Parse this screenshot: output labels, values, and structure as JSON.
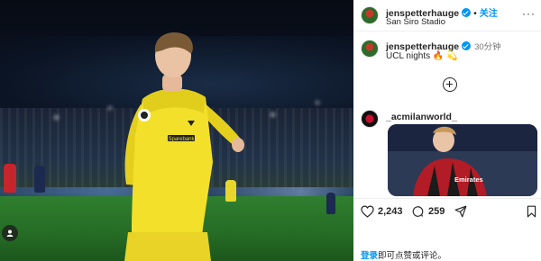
{
  "post": {
    "photo_alt": "",
    "author": {
      "username": "jenspetterhauge",
      "follow_label": "关注",
      "separator": "•",
      "location": "San Siro Stadio"
    },
    "caption": {
      "username": "jenspetterhauge",
      "time_ago": "30分钟",
      "text": "UCL nights 🔥 💫"
    },
    "comment": {
      "username": "_acmilanworld_",
      "embed_image_text": "Emirates"
    },
    "actions": {
      "likes": "2,243",
      "comments": "259"
    },
    "login_prompt": {
      "link_text": "登录",
      "rest_text": "即可点赞或评论。"
    }
  },
  "colors": {
    "accent": "#0095f6",
    "jersey_yellow": "#f3e02a",
    "milan_red": "#c8102e"
  }
}
